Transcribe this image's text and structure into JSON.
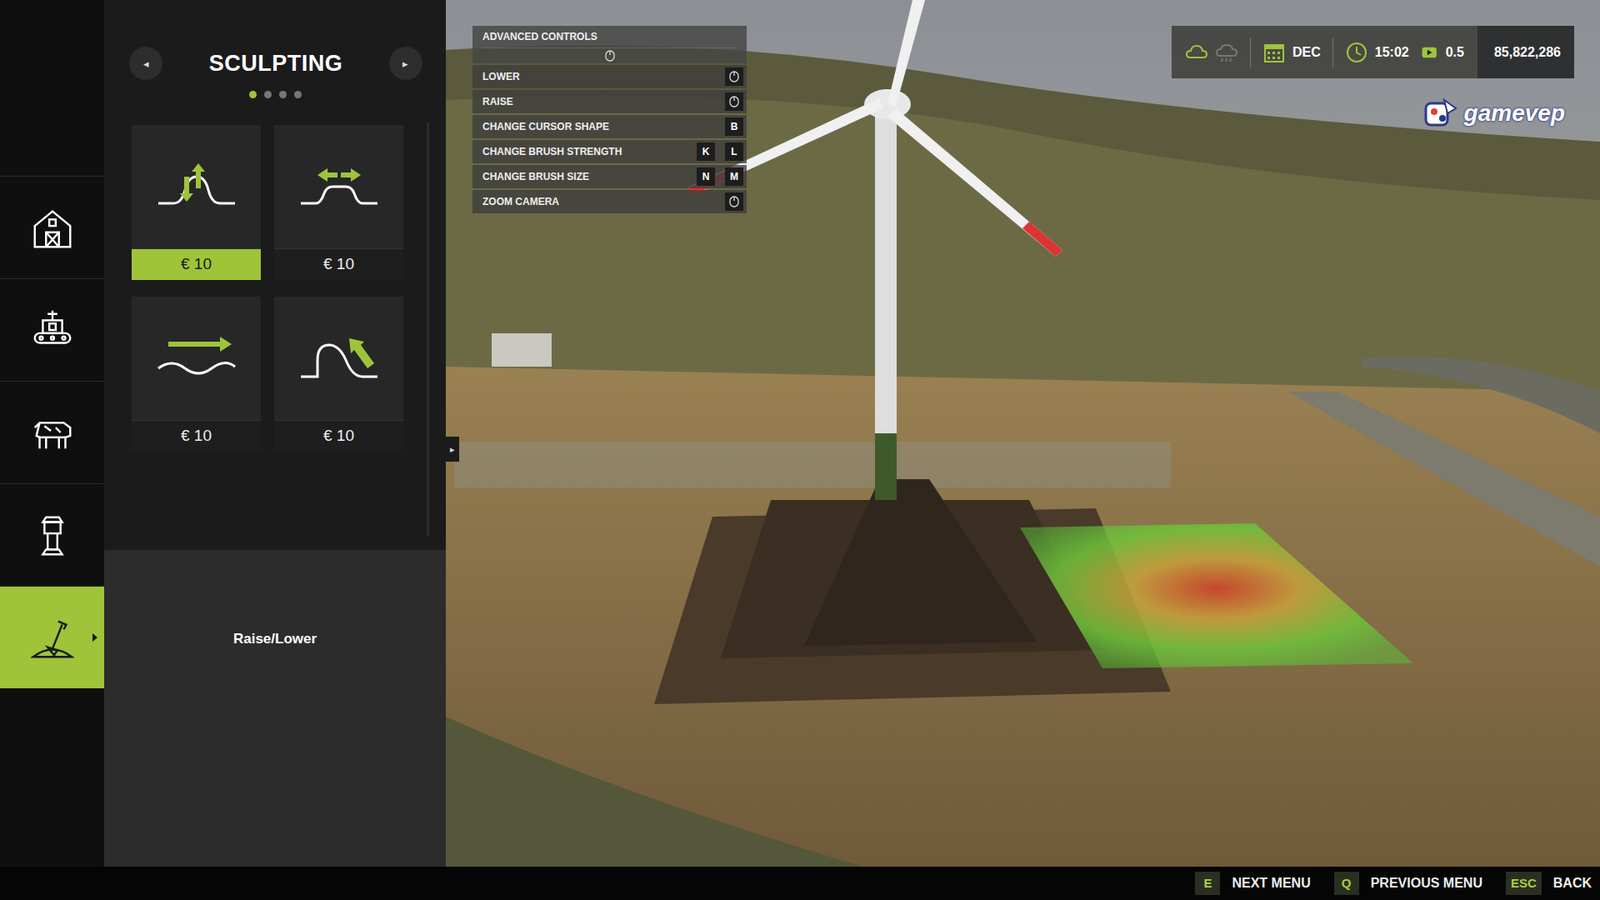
{
  "sidebar": {
    "items": [
      {
        "kind": "farm",
        "selected": false
      },
      {
        "kind": "production",
        "selected": false
      },
      {
        "kind": "animals",
        "selected": false
      },
      {
        "kind": "decoration",
        "selected": false
      },
      {
        "kind": "landscaping",
        "selected": true
      }
    ]
  },
  "panel": {
    "title": "SCULPTING",
    "prev": "◂",
    "next": "▸",
    "pages": [
      {
        "selected": true
      },
      {
        "selected": false
      },
      {
        "selected": false
      },
      {
        "selected": false
      }
    ],
    "tools": [
      {
        "kind": "raise",
        "price": "€ 10",
        "selected": true
      },
      {
        "kind": "flatten",
        "price": "€ 10",
        "selected": false
      },
      {
        "kind": "smooth",
        "price": "€ 10",
        "selected": false
      },
      {
        "kind": "slope",
        "price": "€ 10",
        "selected": false
      }
    ],
    "description": "Raise/Lower",
    "collapse": "▸"
  },
  "controls": {
    "title": "ADVANCED CONTROLS",
    "rows": [
      {
        "label": "LOWER",
        "kind": "mouse",
        "keys": []
      },
      {
        "label": "RAISE",
        "kind": "mouse",
        "keys": []
      },
      {
        "label": "CHANGE CURSOR SHAPE",
        "kind": "keys",
        "keys": [
          "B"
        ]
      },
      {
        "label": "CHANGE BRUSH STRENGTH",
        "kind": "keys",
        "keys": [
          "K",
          "L"
        ]
      },
      {
        "label": "CHANGE BRUSH SIZE",
        "kind": "keys",
        "keys": [
          "N",
          "M"
        ]
      },
      {
        "label": "ZOOM CAMERA",
        "kind": "mouse",
        "keys": []
      }
    ]
  },
  "hud": {
    "month": "DEC",
    "time": "15:02",
    "speed": "0.5",
    "money": "85,822,286"
  },
  "watermark": "gamevep",
  "footer": {
    "actions": [
      {
        "key": "E",
        "label": "NEXT MENU"
      },
      {
        "key": "Q",
        "label": "PREVIOUS MENU"
      },
      {
        "key": "ESC",
        "label": "BACK"
      }
    ]
  }
}
